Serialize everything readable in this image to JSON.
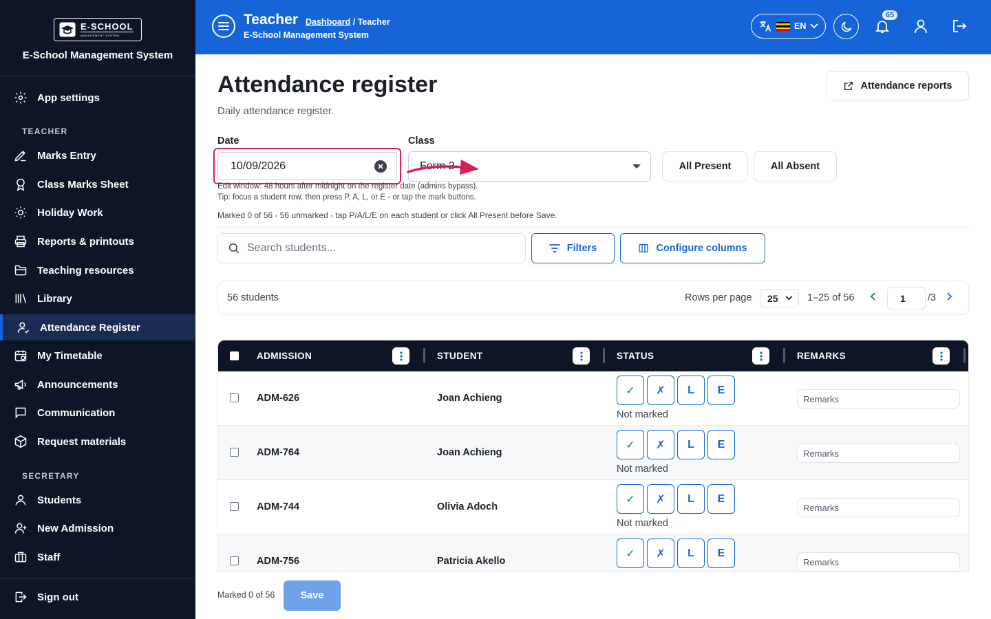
{
  "brand": {
    "logo_name": "E-SCHOOL",
    "logo_sub": "MANAGEMENT SYSTEM",
    "title": "E-School Management System"
  },
  "sidebar": {
    "app_settings": "App settings",
    "section_teacher": "TEACHER",
    "teacher_items": [
      {
        "label": "Marks Entry",
        "icon": "pencil-icon"
      },
      {
        "label": "Class Marks Sheet",
        "icon": "award-icon"
      },
      {
        "label": "Holiday Work",
        "icon": "sun-icon"
      },
      {
        "label": "Reports & printouts",
        "icon": "printer-icon"
      },
      {
        "label": "Teaching resources",
        "icon": "folder-icon"
      },
      {
        "label": "Library",
        "icon": "library-icon"
      },
      {
        "label": "Attendance Register",
        "icon": "user-check-icon",
        "active": true
      },
      {
        "label": "My Timetable",
        "icon": "calendar-icon"
      },
      {
        "label": "Announcements",
        "icon": "megaphone-icon"
      },
      {
        "label": "Communication",
        "icon": "message-icon"
      },
      {
        "label": "Request materials",
        "icon": "box-icon"
      }
    ],
    "section_secretary": "SECRETARY",
    "secretary_items": [
      {
        "label": "Students",
        "icon": "user-icon"
      },
      {
        "label": "New Admission",
        "icon": "user-plus-icon"
      },
      {
        "label": "Staff",
        "icon": "briefcase-icon"
      }
    ],
    "sign_out": "Sign out"
  },
  "header": {
    "title": "Teacher",
    "breadcrumb_link": "Dashboard",
    "breadcrumb_current": "/ Teacher",
    "subtitle": "E-School Management System",
    "language": "EN",
    "notification_count": "65",
    "accent": "#1565d8"
  },
  "page": {
    "title": "Attendance register",
    "subtitle": "Daily attendance register.",
    "reports_button": "Attendance reports",
    "date_label": "Date",
    "date_value": "10/09/2026",
    "class_label": "Class",
    "class_value": "Form 2",
    "all_present": "All Present",
    "all_absent": "All Absent",
    "hint_1": "Edit window: 48 hours after midnight on the register date (admins bypass).",
    "hint_2": "Tip: focus a student row, then press P, A, L, or E - or tap the mark buttons.",
    "status_line": "Marked 0 of 56 - 56 unmarked - tap P/A/L/E on each student or click All Present before Save.",
    "search_placeholder": "Search students...",
    "filters": "Filters",
    "configure_columns": "Configure columns"
  },
  "pager": {
    "count": "56 students",
    "rows_per_page_label": "Rows per page",
    "rows_per_page": "25",
    "range": "1–25 of 56",
    "page": "1",
    "total_pages": "/3"
  },
  "table": {
    "columns": [
      "ADMISSION",
      "STUDENT",
      "STATUS",
      "REMARKS"
    ],
    "mark_labels": [
      "✓",
      "✗",
      "L",
      "E"
    ],
    "not_marked": "Not marked",
    "remarks_placeholder": "Remarks",
    "rows": [
      {
        "admission": "ADM-626",
        "student": "Joan Achieng"
      },
      {
        "admission": "ADM-764",
        "student": "Joan Achieng"
      },
      {
        "admission": "ADM-744",
        "student": "Olivia Adoch"
      },
      {
        "admission": "ADM-756",
        "student": "Patricia Akello"
      }
    ]
  },
  "footer": {
    "marked": "Marked 0 of 56",
    "save": "Save"
  }
}
